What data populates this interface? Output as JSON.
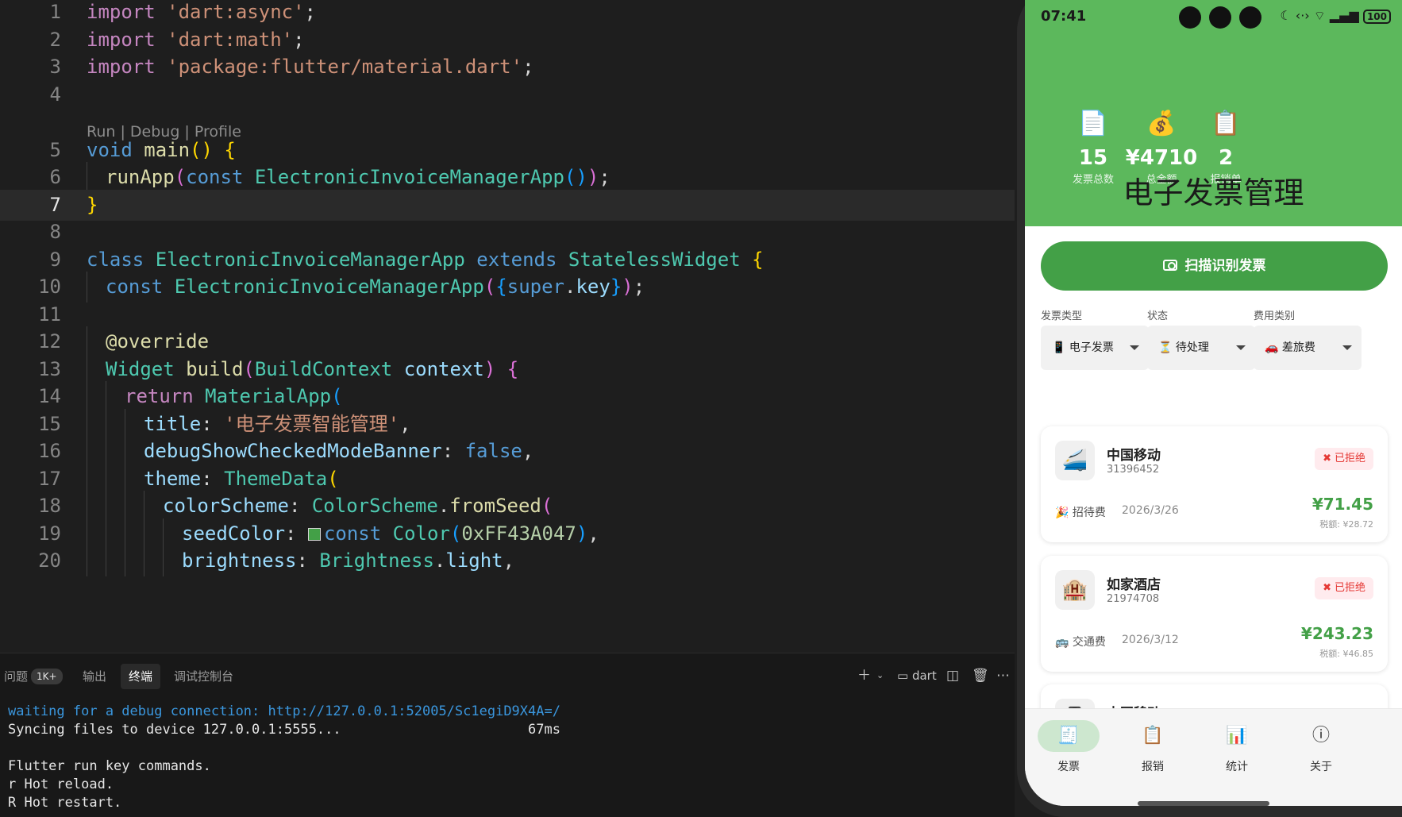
{
  "editor": {
    "lines": [
      {
        "n": "1",
        "parts": [
          [
            "kw",
            "import"
          ],
          [
            "txt",
            " "
          ],
          [
            "str",
            "'dart:async'"
          ],
          [
            "txt",
            ";"
          ]
        ]
      },
      {
        "n": "2",
        "parts": [
          [
            "kw",
            "import"
          ],
          [
            "txt",
            " "
          ],
          [
            "str",
            "'dart:math'"
          ],
          [
            "txt",
            ";"
          ]
        ]
      },
      {
        "n": "3",
        "parts": [
          [
            "kw",
            "import"
          ],
          [
            "txt",
            " "
          ],
          [
            "str",
            "'package:flutter/material.dart'"
          ],
          [
            "txt",
            ";"
          ]
        ]
      },
      {
        "n": "4",
        "parts": []
      },
      {
        "n": "5",
        "parts": [
          [
            "kw2",
            "void"
          ],
          [
            "txt",
            " "
          ],
          [
            "fn",
            "main"
          ],
          [
            "y",
            "()"
          ],
          [
            "txt",
            " "
          ],
          [
            "y",
            "{"
          ]
        ]
      },
      {
        "n": "6",
        "parts": [
          [
            "fn",
            "runApp"
          ],
          [
            "p",
            "("
          ],
          [
            "kw2",
            "const"
          ],
          [
            "txt",
            " "
          ],
          [
            "cls",
            "ElectronicInvoiceManagerApp"
          ],
          [
            "b",
            "()"
          ],
          [
            "p",
            ")"
          ],
          [
            "txt",
            ";"
          ]
        ]
      },
      {
        "n": "7",
        "parts": [
          [
            "y",
            "}"
          ]
        ]
      },
      {
        "n": "8",
        "parts": []
      },
      {
        "n": "9",
        "parts": [
          [
            "kw2",
            "class"
          ],
          [
            "txt",
            " "
          ],
          [
            "cls",
            "ElectronicInvoiceManagerApp"
          ],
          [
            "txt",
            " "
          ],
          [
            "kw2",
            "extends"
          ],
          [
            "txt",
            " "
          ],
          [
            "cls",
            "StatelessWidget"
          ],
          [
            "txt",
            " "
          ],
          [
            "y",
            "{"
          ]
        ]
      },
      {
        "n": "10",
        "parts": [
          [
            "kw2",
            "const"
          ],
          [
            "txt",
            " "
          ],
          [
            "cls",
            "ElectronicInvoiceManagerApp"
          ],
          [
            "p",
            "("
          ],
          [
            "b",
            "{"
          ],
          [
            "kw2",
            "super"
          ],
          [
            "txt",
            "."
          ],
          [
            "prop",
            "key"
          ],
          [
            "b",
            "}"
          ],
          [
            "p",
            ")"
          ],
          [
            "txt",
            ";"
          ]
        ]
      },
      {
        "n": "11",
        "parts": []
      },
      {
        "n": "12",
        "parts": [
          [
            "fn",
            "@override"
          ]
        ]
      },
      {
        "n": "13",
        "parts": [
          [
            "cls",
            "Widget"
          ],
          [
            "txt",
            " "
          ],
          [
            "fn",
            "build"
          ],
          [
            "p",
            "("
          ],
          [
            "cls",
            "BuildContext"
          ],
          [
            "txt",
            " "
          ],
          [
            "prop",
            "context"
          ],
          [
            "p",
            ")"
          ],
          [
            "txt",
            " "
          ],
          [
            "p",
            "{"
          ]
        ]
      },
      {
        "n": "14",
        "parts": [
          [
            "kw",
            "return"
          ],
          [
            "txt",
            " "
          ],
          [
            "cls",
            "MaterialApp"
          ],
          [
            "b",
            "("
          ]
        ]
      },
      {
        "n": "15",
        "parts": [
          [
            "prop",
            "title"
          ],
          [
            "txt",
            ": "
          ],
          [
            "str",
            "'电子发票智能管理'"
          ],
          [
            "txt",
            ","
          ]
        ]
      },
      {
        "n": "16",
        "parts": [
          [
            "prop",
            "debugShowCheckedModeBanner"
          ],
          [
            "txt",
            ": "
          ],
          [
            "kw2",
            "false"
          ],
          [
            "txt",
            ","
          ]
        ]
      },
      {
        "n": "17",
        "parts": [
          [
            "prop",
            "theme"
          ],
          [
            "txt",
            ": "
          ],
          [
            "cls",
            "ThemeData"
          ],
          [
            "y",
            "("
          ]
        ]
      },
      {
        "n": "18",
        "parts": [
          [
            "prop",
            "colorScheme"
          ],
          [
            "txt",
            ": "
          ],
          [
            "cls",
            "ColorScheme"
          ],
          [
            "txt",
            "."
          ],
          [
            "fn",
            "fromSeed"
          ],
          [
            "p",
            "("
          ]
        ]
      },
      {
        "n": "19",
        "parts": [
          [
            "prop",
            "seedColor"
          ],
          [
            "txt",
            ": "
          ],
          [
            "swatch",
            ""
          ],
          [
            "kw2",
            "const"
          ],
          [
            "txt",
            " "
          ],
          [
            "cls",
            "Color"
          ],
          [
            "b",
            "("
          ],
          [
            "num",
            "0xFF43A047"
          ],
          [
            "b",
            ")"
          ],
          [
            "txt",
            ","
          ]
        ]
      },
      {
        "n": "20",
        "parts": [
          [
            "prop",
            "brightness"
          ],
          [
            "txt",
            ": "
          ],
          [
            "cls",
            "Brightness"
          ],
          [
            "txt",
            "."
          ],
          [
            "prop",
            "light"
          ],
          [
            "txt",
            ","
          ]
        ]
      }
    ],
    "codelens": "Run | Debug | Profile"
  },
  "panel": {
    "tabs": {
      "problems": "问题",
      "problems_badge": "1K+",
      "output": "输出",
      "terminal": "终端",
      "debug_console": "调试控制台"
    },
    "terminal_name": "dart",
    "terminal_lines": [
      {
        "cls": "blue",
        "text": "waiting for a debug connection: http://127.0.0.1:52005/Sc1egiD9X4A=/"
      },
      {
        "cls": "",
        "text": "Syncing files to device 127.0.0.1:5555...                       67ms"
      },
      {
        "cls": "",
        "text": " "
      },
      {
        "cls": "",
        "text": "Flutter run key commands."
      },
      {
        "cls": "",
        "text": "r Hot reload."
      },
      {
        "cls": "",
        "text": "R Hot restart."
      }
    ]
  },
  "phone": {
    "status_time": "07:41",
    "battery": "100",
    "stats": [
      {
        "icon": "📄",
        "value": "15",
        "label": "发票总数"
      },
      {
        "icon": "💰",
        "value": "¥4710",
        "label": "总金额"
      },
      {
        "icon": "📋",
        "value": "2",
        "label": "报销单"
      }
    ],
    "app_title": "电子发票管理",
    "scan_button": "扫描识别发票",
    "filters": [
      {
        "label": "发票类型",
        "icon": "📱",
        "value": "电子发票"
      },
      {
        "label": "状态",
        "icon": "⏳",
        "value": "待处理"
      },
      {
        "label": "费用类别",
        "icon": "🚗",
        "value": "差旅费"
      }
    ],
    "invoices": [
      {
        "logo": "🚄",
        "merchant": "中国移动",
        "number": "31396452",
        "status": "已拒绝",
        "cat_icon": "🎉",
        "category": "招待费",
        "date": "2026/3/26",
        "amount": "¥71.45",
        "tax": "税额: ¥28.72"
      },
      {
        "logo": "🏨",
        "merchant": "如家酒店",
        "number": "21974708",
        "status": "已拒绝",
        "cat_icon": "🚌",
        "category": "交通费",
        "date": "2026/3/12",
        "amount": "¥243.23",
        "tax": "税额: ¥46.85"
      },
      {
        "logo": "📱",
        "merchant": "中国移动",
        "number": "",
        "status": "",
        "cat_icon": "",
        "category": "",
        "date": "",
        "amount": "",
        "tax": ""
      }
    ],
    "nav": [
      {
        "icon": "🧾",
        "label": "发票",
        "active": true
      },
      {
        "icon": "📋",
        "label": "报销",
        "active": false
      },
      {
        "icon": "📊",
        "label": "统计",
        "active": false
      },
      {
        "icon": "ⓘ",
        "label": "关于",
        "active": false
      }
    ]
  }
}
